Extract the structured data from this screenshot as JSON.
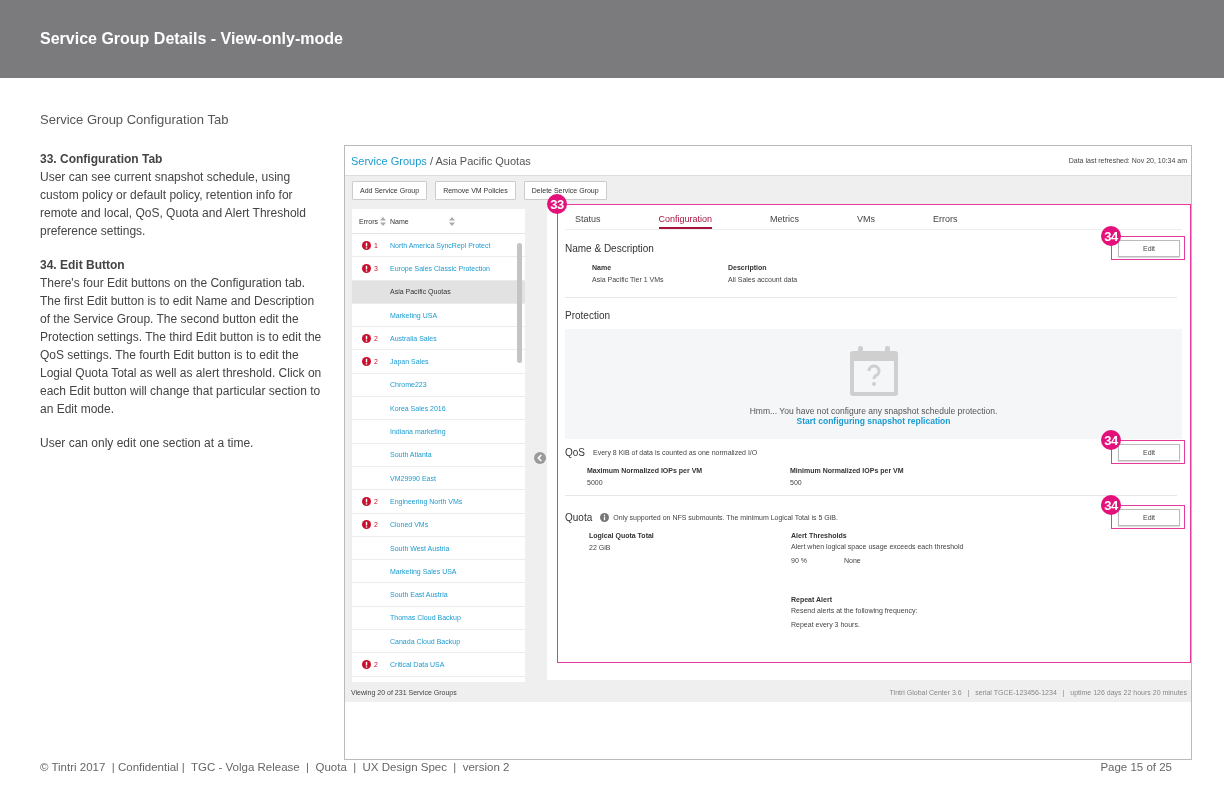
{
  "header": {
    "title": "Service Group Details - View-only-mode"
  },
  "subtitle": "Service Group Configuration Tab",
  "notes": [
    {
      "heading": "33. Configuration Tab",
      "text": "User can see current snapshot schedule, using custom policy or default policy, retention info for remote and local, QoS, Quota and Alert Threshold preference settings."
    },
    {
      "heading": "34. Edit Button",
      "text": "There's four Edit buttons on the Configuration tab. The first Edit button is to edit Name and Description of the Service Group. The second button edit the Protection settings. The third Edit button is to edit the QoS settings. The fourth Edit button is to edit the Logial Quota Total as well as alert threshold. Click on each Edit button will change that particular section to an Edit mode."
    },
    {
      "text": "User can only edit one section at a time."
    }
  ],
  "screen": {
    "breadcrumb": {
      "link": "Service Groups",
      "separator": "/",
      "current": "Asia Pacific Quotas"
    },
    "refreshed": "Data last refreshed: Nov 20, 10:34 am",
    "toolbar": [
      "Add Service Group",
      "Remove VM Policies",
      "Delete Service Group"
    ],
    "list": {
      "columns": [
        "Errors",
        "Name"
      ],
      "rows": [
        {
          "errors": "1",
          "name": "North America SyncRepl Protect",
          "selected": false
        },
        {
          "errors": "3",
          "name": "Europe Sales Classic Protection",
          "selected": false
        },
        {
          "name": "Asia Pacific Quotas",
          "selected": true
        },
        {
          "name": "Marketing USA",
          "selected": false
        },
        {
          "errors": "2",
          "name": "Australia Sales",
          "selected": false
        },
        {
          "errors": "2",
          "name": "Japan Sales",
          "selected": false
        },
        {
          "name": "Chrome223",
          "selected": false
        },
        {
          "name": "Korea Sales 2016",
          "selected": false
        },
        {
          "name": "Indiana marketing",
          "selected": false
        },
        {
          "name": "South Atlanta",
          "selected": false
        },
        {
          "name": "VM29990 East",
          "selected": false
        },
        {
          "errors": "2",
          "name": "Engineering North VMs",
          "selected": false
        },
        {
          "errors": "2",
          "name": "Cloned VMs",
          "selected": false
        },
        {
          "name": "South West Austria",
          "selected": false
        },
        {
          "name": "Marketing Sales USA",
          "selected": false
        },
        {
          "name": "South East Austria",
          "selected": false
        },
        {
          "name": "Thomas Cloud Backup",
          "selected": false
        },
        {
          "name": "Canada Cloud Backup",
          "selected": false
        },
        {
          "errors": "2",
          "name": "Critical Data USA",
          "selected": false
        }
      ],
      "status": "Viewing 20 of 231 Service Groups"
    },
    "annotation": "33",
    "tabs": [
      {
        "label": "Status",
        "selected": false
      },
      {
        "label": "Configuration",
        "selected": true
      },
      {
        "label": "Metrics",
        "selected": false
      },
      {
        "label": "VMs",
        "selected": false
      },
      {
        "label": "Errors",
        "selected": false
      }
    ],
    "name_description": {
      "title": "Name & Description",
      "edit": "Edit",
      "annotation": "34",
      "fields": [
        {
          "label": "Name",
          "value": "Asia Pacific Tier 1 VMs"
        },
        {
          "label": "Description",
          "value": "All Sales account data"
        }
      ]
    },
    "protection": {
      "title": "Protection",
      "message": "Hmm... You have not configure any snapshot schedule protection.",
      "link": "Start configuring snapshot replication"
    },
    "qos": {
      "title": "QoS",
      "note": "Every 8 KiB of data is counted as one normalized I/O",
      "edit": "Edit",
      "annotation": "34",
      "fields": [
        {
          "label": "Maximum Normalized IOPs per VM",
          "value": "5000"
        },
        {
          "label": "Minimum Normalized IOPs per VM",
          "value": "500"
        }
      ]
    },
    "quota": {
      "title": "Quota",
      "note": "Only supported on NFS submounts. The minimum Logical Total is 5 GiB.",
      "edit": "Edit",
      "annotation": "34",
      "total": {
        "label": "Logical Quota Total",
        "value": "22 GiB"
      },
      "thresholds": {
        "label": "Alert Thresholds",
        "description": "Alert when logical space usage exceeds each threshold",
        "values": [
          "90 %",
          "None"
        ]
      },
      "repeat": {
        "label": "Repeat Alert",
        "description": "Resend alerts at the following frequency:",
        "value": "Repeat every 3 hours."
      }
    },
    "footer": "Tintri Global Center 3.6   |   serial TGCE-123456-1234   |   uptime 126 days 22 hours 20 minutes"
  },
  "footer": {
    "left": "© Tintri 2017  | Confidential |  TGC - Volga Release  |  Quota  |  UX Design Spec  |  version 2",
    "right": "Page 15 of 25"
  }
}
